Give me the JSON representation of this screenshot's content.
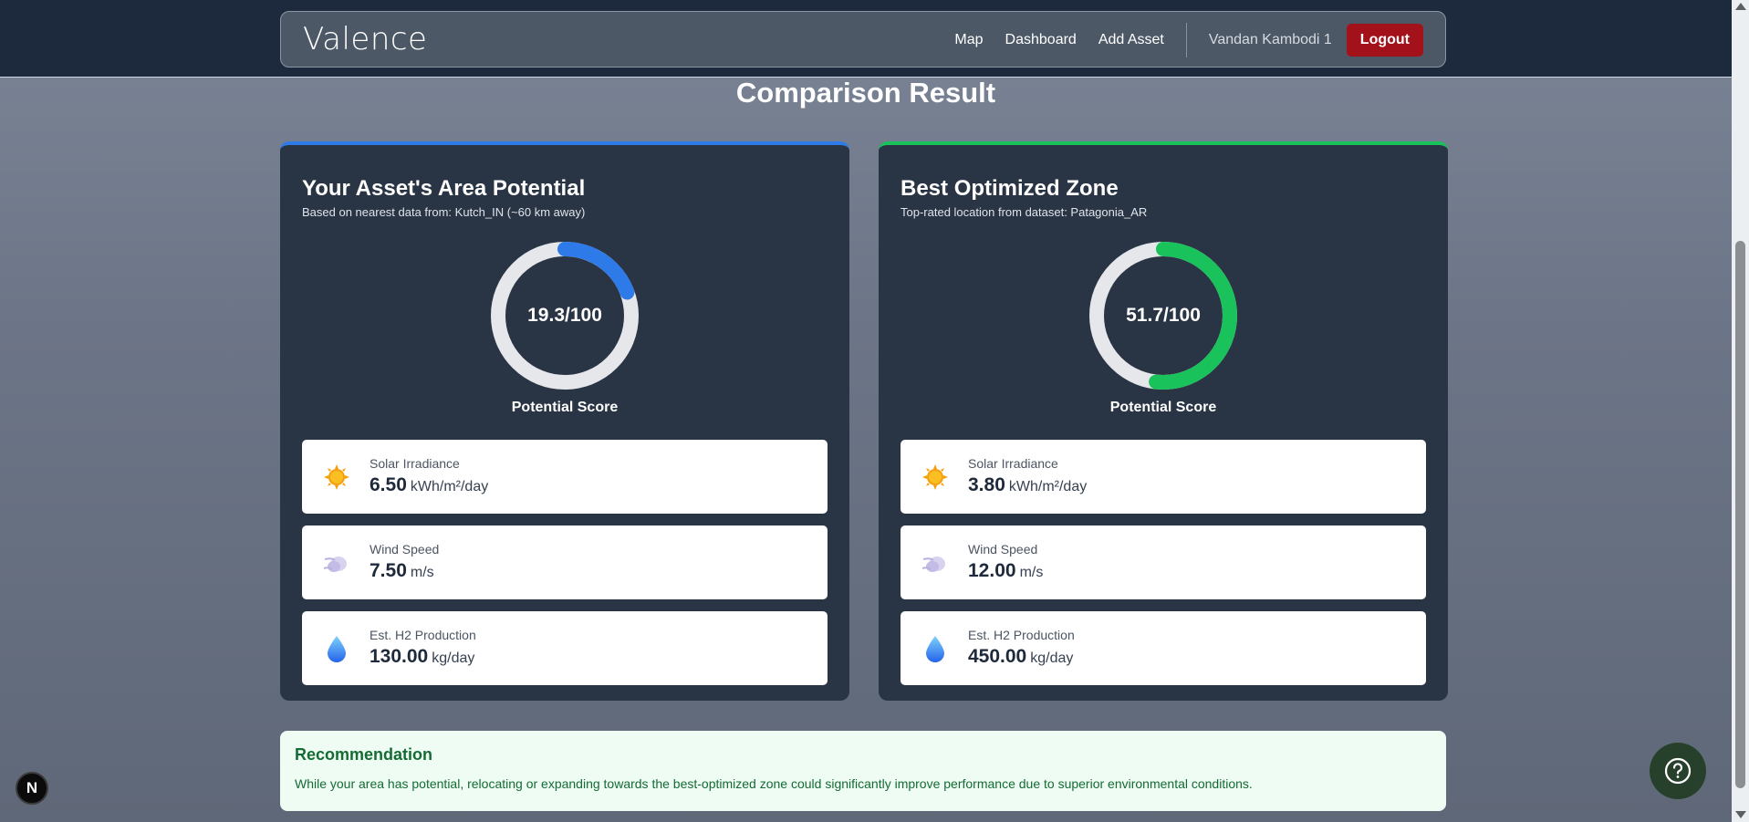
{
  "app": {
    "logo": "Valence"
  },
  "nav": {
    "links": [
      "Map",
      "Dashboard",
      "Add Asset"
    ],
    "user": "Vandan Kambodi 1",
    "logout_label": "Logout"
  },
  "page_title": "Comparison Result",
  "cards": [
    {
      "title": "Your Asset's Area Potential",
      "subtitle": "Based on nearest data from: Kutch_IN (~60 km away)",
      "score_text": "19.3/100",
      "score": 19.3,
      "score_label": "Potential Score",
      "accent": "#2d7ae8",
      "metrics": [
        {
          "label": "Solar Irradiance",
          "value": "6.50",
          "unit": "kWh/m²/day",
          "icon": "sun-icon"
        },
        {
          "label": "Wind Speed",
          "value": "7.50",
          "unit": "m/s",
          "icon": "wind-cloud-icon"
        },
        {
          "label": "Est. H2 Production",
          "value": "130.00",
          "unit": "kg/day",
          "icon": "water-drop-icon"
        }
      ]
    },
    {
      "title": "Best Optimized Zone",
      "subtitle": "Top-rated location from dataset: Patagonia_AR",
      "score_text": "51.7/100",
      "score": 51.7,
      "score_label": "Potential Score",
      "accent": "#19c25a",
      "metrics": [
        {
          "label": "Solar Irradiance",
          "value": "3.80",
          "unit": "kWh/m²/day",
          "icon": "sun-icon"
        },
        {
          "label": "Wind Speed",
          "value": "12.00",
          "unit": "m/s",
          "icon": "wind-cloud-icon"
        },
        {
          "label": "Est. H2 Production",
          "value": "450.00",
          "unit": "kg/day",
          "icon": "water-drop-icon"
        }
      ]
    }
  ],
  "recommendation": {
    "title": "Recommendation",
    "text": "While your area has potential, relocating or expanding towards the best-optimized zone could significantly improve performance due to superior environmental conditions."
  },
  "badge": "N"
}
